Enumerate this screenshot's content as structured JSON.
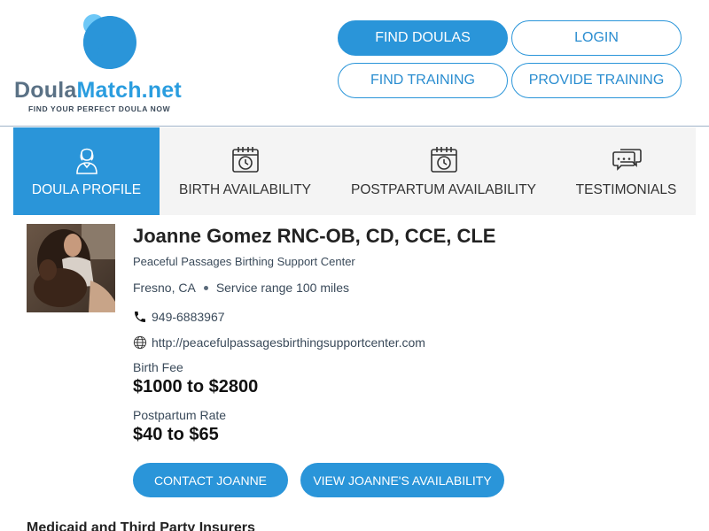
{
  "brand": {
    "name_part1": "Doula",
    "name_part2": "Match.net",
    "tagline": "FIND YOUR PERFECT DOULA NOW"
  },
  "nav": {
    "find_doulas": "FIND DOULAS",
    "login": "LOGIN",
    "find_training": "FIND TRAINING",
    "provide_training": "PROVIDE TRAINING"
  },
  "tabs": [
    {
      "label": "DOULA PROFILE",
      "icon": "doula-person-icon",
      "active": true
    },
    {
      "label": "BIRTH AVAILABILITY",
      "icon": "calendar-clock-icon",
      "active": false
    },
    {
      "label": "POSTPARTUM AVAILABILITY",
      "icon": "calendar-clock-icon",
      "active": false
    },
    {
      "label": "TESTIMONIALS",
      "icon": "chat-bubbles-icon",
      "active": false
    }
  ],
  "profile": {
    "name": "Joanne Gomez RNC-OB, CD, CCE, CLE",
    "organization": "Peaceful Passages Birthing Support Center",
    "city": "Fresno, CA",
    "service_range": "Service range 100 miles",
    "phone": "949-6883967",
    "website": "http://peacefulpassagesbirthingsupportcenter.com",
    "birth_fee_label": "Birth Fee",
    "birth_fee": "$1000 to $2800",
    "postpartum_label": "Postpartum Rate",
    "postpartum_rate": "$40 to $65",
    "contact_button": "CONTACT JOANNE",
    "availability_button": "VIEW JOANNE'S AVAILABILITY"
  },
  "sections": {
    "insurers_heading": "Medicaid and Third Party Insurers"
  },
  "colors": {
    "accent": "#2a95d9",
    "tab_bg": "#f4f4f4",
    "logo_gray": "#5a7185"
  }
}
